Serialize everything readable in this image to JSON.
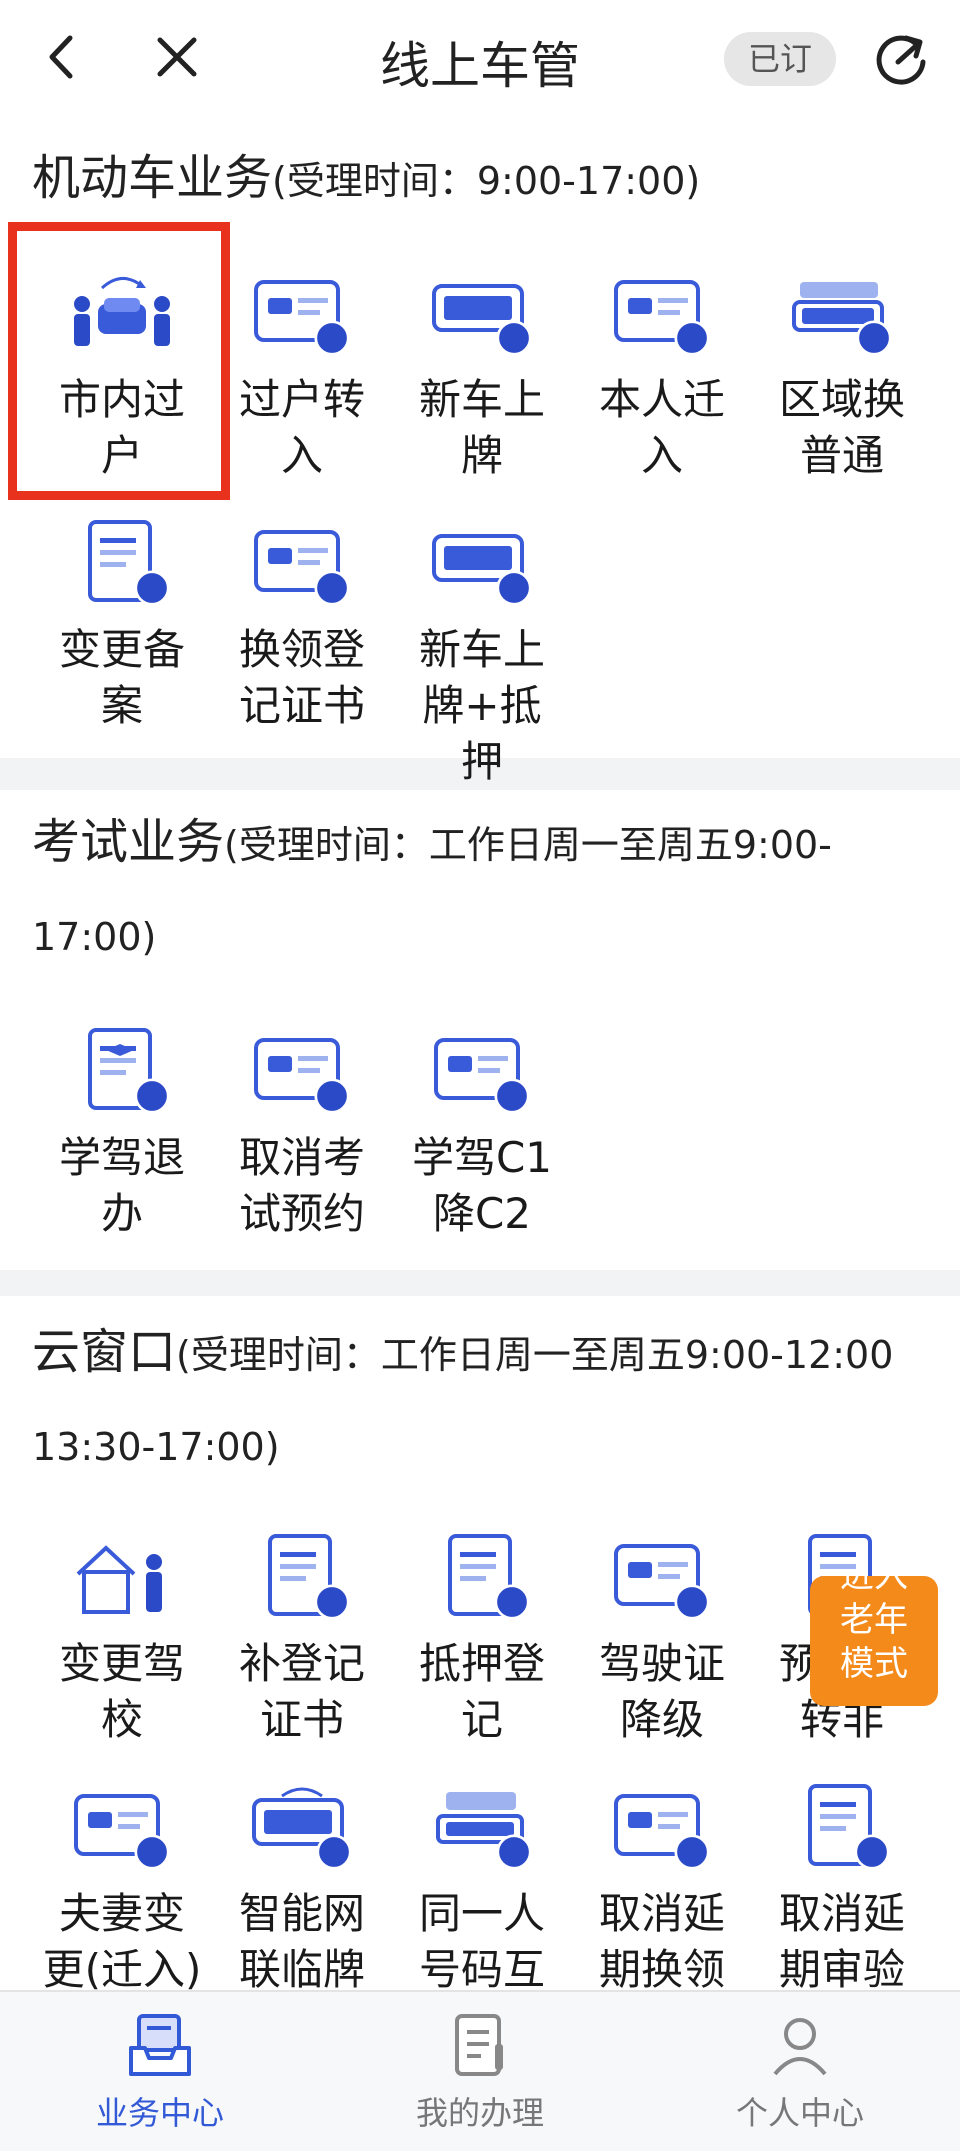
{
  "header": {
    "title": "线上车管",
    "subscribe_label": "已订",
    "icons": {
      "back": "chevron-left-icon",
      "close": "close-icon",
      "refresh": "refresh-icon"
    }
  },
  "sections": [
    {
      "title": "机动车业务",
      "note": "(受理时间：9:00-17:00)",
      "items": [
        {
          "label": "市内过户",
          "icon": "car-people-icon"
        },
        {
          "label": "过户转入",
          "icon": "plate-in-icon"
        },
        {
          "label": "新车上牌",
          "icon": "plate-new-icon"
        },
        {
          "label": "本人迁入",
          "icon": "card-person-icon"
        },
        {
          "label": "区域换普通",
          "icon": "plate-swap-icon"
        },
        {
          "label": "变更备案",
          "icon": "doc-refresh-icon"
        },
        {
          "label": "换领登记证书",
          "icon": "cert-swap-icon"
        },
        {
          "label": "新车上牌+抵押",
          "icon": "plate-new-mortgage-icon"
        }
      ]
    },
    {
      "title": "考试业务",
      "note": "(受理时间：工作日周一至周五9:00-17:00)",
      "items": [
        {
          "label": "学驾退办",
          "icon": "student-cancel-icon"
        },
        {
          "label": "取消考试预约",
          "icon": "card-cancel-icon"
        },
        {
          "label": "学驾C1降C2",
          "icon": "c1-downgrade-icon"
        }
      ]
    },
    {
      "title": "云窗口",
      "note": "(受理时间：工作日周一至周五9:00-12:00 13:30-17:00)",
      "items": [
        {
          "label": "变更驾校",
          "icon": "school-change-icon"
        },
        {
          "label": "补登记证书",
          "icon": "cert-supplement-icon"
        },
        {
          "label": "抵押登记",
          "icon": "doc-mortgage-icon"
        },
        {
          "label": "驾驶证降级",
          "icon": "license-downgrade-icon"
        },
        {
          "label": "预约租转非",
          "icon": "rental-convert-icon"
        },
        {
          "label": "夫妻变更(迁入)",
          "icon": "couple-change-icon"
        },
        {
          "label": "智能网联临牌",
          "icon": "temp-plate-icon"
        },
        {
          "label": "同一人号码互换",
          "icon": "number-swap-icon"
        },
        {
          "label": "取消延期换领",
          "icon": "cancel-delay-renew-icon"
        },
        {
          "label": "取消延期审验",
          "icon": "cancel-delay-review-icon"
        }
      ]
    }
  ],
  "elder_mode": {
    "line1": "进入",
    "line2": "老年",
    "line3": "模式"
  },
  "tabbar": [
    {
      "label": "业务中心",
      "icon": "inbox-tray-icon",
      "active": true
    },
    {
      "label": "我的办理",
      "icon": "document-list-icon",
      "active": false
    },
    {
      "label": "个人中心",
      "icon": "user-icon",
      "active": false
    }
  ],
  "colors": {
    "accent": "#3259d6",
    "highlight": "#e8321e",
    "elder_button": "#f48a1a"
  }
}
